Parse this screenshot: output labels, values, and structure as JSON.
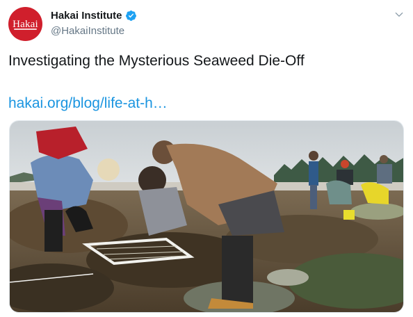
{
  "tweet": {
    "author": {
      "display_name": "Hakai Institute",
      "handle": "@HakaiInstitute",
      "avatar_text": "Hakai",
      "verified": true
    },
    "text": "Investigating the Mysterious Seaweed Die-Off",
    "link_text": "hakai.org/blog/life-at-h…",
    "media": {
      "type": "photo",
      "icon": "photo-icon"
    }
  },
  "colors": {
    "avatar_bg": "#d01f2c",
    "link": "#1b95e0",
    "verified": "#1da1f2",
    "muted": "#657786"
  }
}
